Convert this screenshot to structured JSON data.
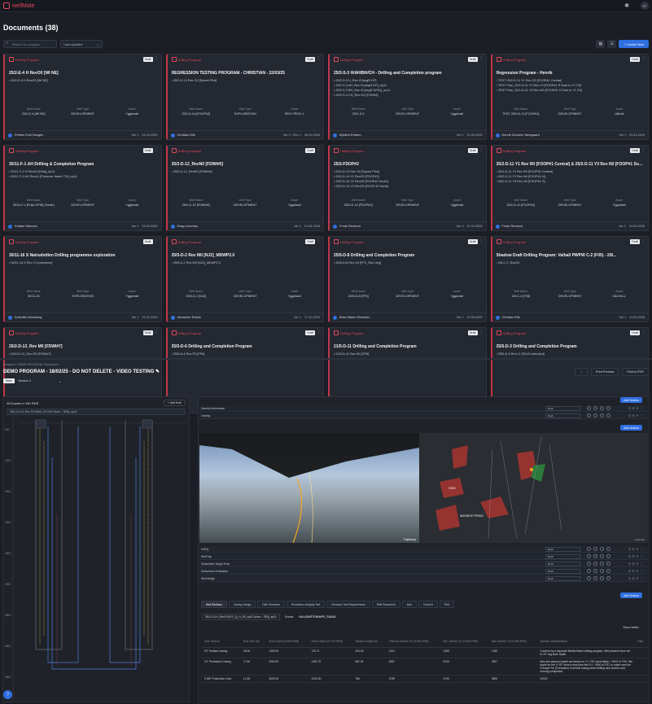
{
  "app": {
    "name": "wellMate",
    "user_initials": "RF"
  },
  "documents_title": "Documents (38)",
  "search": {
    "placeholder": "Search for program"
  },
  "sort": {
    "value": "Last updated"
  },
  "create_button": "+ Create New",
  "meta_labels": {
    "well": "Well Name",
    "type": "Well Type",
    "asset": "Asset"
  },
  "cards": [
    {
      "type": "Drilling Program",
      "badge": "Draft",
      "title": "25/2-E-4 H RevO0 [WI NE]",
      "items": [
        "25/2-E-4 H RevO0 [WI NE]"
      ],
      "well": "25/2-E-4 [WI NE]",
      "wtype": "DEVELOPMENT",
      "asset": "Yggdrasil",
      "user": "Preben Emil Haugen",
      "version": "Ver 1",
      "date": "01.04.2025"
    },
    {
      "type": "Drilling Program",
      "badge": "Draft",
      "title": "REGRESSION TESTING PROGRAM - CHRISTIAN - 22/03/25",
      "items": [
        "25/2-D-14 Rev G0 [Speed Pilot]"
      ],
      "well": "25/2-D-14 [FOOP#2]",
      "wtype": "EXPLORATION",
      "asset": "REG PROG 1",
      "user": "Christian Elle",
      "version": "Ver 3 - Rev 1",
      "date": "26.03.2025"
    },
    {
      "type": "Drilling Program",
      "badge": "Draft",
      "title": "25/2-S-3 H/AH/BH/CH - Drilling and Completion program",
      "items": [
        "25/2-S-3 H_Rev I0 [segR-DP]",
        "25/2-S-3 AH_Rev I0 [segR-DP]_ep11",
        "25/2-S-3 BH_Rev I0 [segR-DP#1]_ep11",
        "25/2-S-3 CH_Rev G0 [FOPAH]"
      ],
      "well": "25/2-S-3",
      "wtype": "DEVELOPMENT",
      "asset": "Yggdrasil",
      "user": "Øystein Eriksen",
      "version": "Ver 1",
      "date": "01.04.2025"
    },
    {
      "type": "Drilling Program",
      "badge": "Draft",
      "title": "Regression Program - Henrik",
      "items": [
        "TEST 25/2-D-11 Y1 Rev G0 [FOOP#1 Central]",
        "TEST Pian_25/2-D-11 Y2 Rev L0 [FOOP#1 R East to Y1 G0]",
        "TEST Pian_25/2-D-11 Y3 Rev M0 [FOOP#1 S East to Y1 G0]"
      ],
      "well": "TEST 25/2-D-11 [FOOP#1]",
      "wtype": "DEVELOPMENT",
      "asset": "Valhall",
      "user": "Henrik Schoeler Nøregaard",
      "version": "Ver 1",
      "date": "03.11.2024"
    },
    {
      "type": "Drilling Program",
      "badge": "Draft",
      "title": "30/11-F-1 AH Drilling & Completion Program",
      "items": [
        "30/11-F-1 H RevA0 [Fulla]_ep11",
        "30/11-F-1 AH RevA1 [Producer frame TDI]_ep11"
      ],
      "well": "30/11-F-1 [Fulla DPIS] (South)",
      "wtype": "DEVELOPMENT",
      "asset": "Yggdrasil",
      "user": "Kristian Wannes",
      "version": "Ver 1",
      "date": "03.03.2025"
    },
    {
      "type": "Drilling Program",
      "badge": "Draft",
      "title": "25/2-D-12_RevN0 [FDWI#5]",
      "items": [
        "25/2-D-12_RevN0 [FDWI#5]"
      ],
      "well": "25/2-D-12 [FDWI#5]",
      "wtype": "DEVELOPMENT",
      "asset": "Yggdrasil",
      "user": "Diego Acevedo",
      "version": "Ver 1",
      "date": "01.04.2025"
    },
    {
      "type": "Drilling Program",
      "badge": "Draft",
      "title": "25/2-FDOP#2",
      "items": [
        "25/2-D-14 Rev G0 [Speed Pilot]",
        "25/2-D-14 Y1 RevG0 [FDOP#2]",
        "25/2-D-14 Y2 RevG0 [FDOP#2 South]",
        "25/2-D-14 Y3 RevG0 [FDOP #2 North]"
      ],
      "well": "25/2-D-14 [FDOP#2]",
      "wtype": "DEVELOPMENT",
      "asset": "Yggdrasil",
      "user": "Frode Rivelund",
      "version": "Ver 3",
      "date": "01.04.2025"
    },
    {
      "type": "Drilling Program",
      "badge": "Draft",
      "title": "25/2-D-11 Y1 Rev R0 [FOOP#1 Central] & 25/2-D-11 Y3 Rev N0 [FOOP#1 South]",
      "items": [
        "25/2-D-11 Y1 Rev R0 [FOOP#1 Central]",
        "25/2-D-11 Y2 Rev N0 [FOOP#1 N]",
        "25/2-D-11 Y3 Rev N0 [FOOP#1 S]"
      ],
      "well": "25/2-D-11 [FOOP#1]",
      "wtype": "DEVELOPMENT",
      "asset": "Yggdrasil",
      "user": "Frode Rivelund",
      "version": "Ver 1",
      "date": "24.03.2025"
    },
    {
      "type": "Drilling Program",
      "badge": "Draft",
      "title": "30/11-16 S Natrudstilen Drilling programme exploration",
      "items": [
        "30/11-16 S Rev C1 [mainbore]"
      ],
      "well": "30/11-16",
      "wtype": "EXPLORATION",
      "asset": "Yggdrasil",
      "user": "Kristoffer Wansberg",
      "version": "Ver 1",
      "date": "07.01.2025"
    },
    {
      "type": "Drilling Program",
      "badge": "Draft",
      "title": "25/5-D-2 Rev M0 [NJ2]_MDWP2.0",
      "items": [
        "25/5-D-2 Rev M0 [NJ2]_MDWP2.0"
      ],
      "well": "25/5-D-2 [NJ2]",
      "wtype": "DEVELOPMENT",
      "asset": "Yggdrasil",
      "user": "Alexander Eriskis",
      "version": "Ver 1",
      "date": "17.10.2024"
    },
    {
      "type": "Drilling Program",
      "badge": "Draft",
      "title": "25/5-D-8 Drilling and Completion Program",
      "items": [
        "25/5-D-8 Rev U3 [FP4_Slot Ling]"
      ],
      "well": "25/5-D-8 [FP4]",
      "wtype": "DEVELOPMENT",
      "asset": "Yggdrasil",
      "user": "Brian Nilsen Sivertsen",
      "version": "Ver 1",
      "date": "22.08.2025"
    },
    {
      "type": "Drilling Program",
      "badge": "Draft",
      "title": "Shadow Draft Drilling Program: Valhall PWPW C-2 (F05) - 2/8...",
      "items": [
        "2/8-C-2_RevD3"
      ],
      "well": "2/8-C-2 [F05]",
      "wtype": "DEVELOPMENT",
      "asset": "VALHALL",
      "user": "Christian Elle",
      "version": "Ver 1",
      "date": "11.03.2025"
    },
    {
      "type": "Drilling Program",
      "badge": "Draft",
      "title": "25/2-D-13_Rev M0 [FDWI#7]",
      "items": [
        "25/2-D-13_Rev M0 [FDWI#7]"
      ],
      "well": "",
      "wtype": "",
      "asset": "",
      "user": "",
      "version": "",
      "date": ""
    },
    {
      "type": "Drilling Program",
      "badge": "Draft",
      "title": "25/5-D-6 Drilling and Completion Program",
      "items": [
        "25/5-D-6 Rev P0 [FP6]"
      ],
      "well": "",
      "wtype": "",
      "asset": "",
      "user": "",
      "version": "",
      "date": ""
    },
    {
      "type": "Drilling Program",
      "badge": "Draft",
      "title": "21/5-D-11 Drilling and Completion Program",
      "items": [
        "21/5-D-11 Rev M1 [FP5]"
      ],
      "well": "",
      "wtype": "",
      "asset": "",
      "user": "",
      "version": "",
      "date": ""
    },
    {
      "type": "Drilling Program",
      "badge": "Draft",
      "title": "25/5-D-3 Drilling and Completion Program",
      "items": [
        "25/5-D-3 Rev L1 [FNJ3 extended]"
      ],
      "well": "",
      "wtype": "",
      "asset": "",
      "user": "",
      "version": "",
      "date": ""
    }
  ],
  "demo": {
    "breadcrumb": "Programs / DEMO PROGRAM / Dashboard",
    "title": "DEMO PROGRAM - 18/02/25 - DO NOT DELETE - VIDEO TESTING",
    "print_preview": "Print Preview",
    "print_pdf": "Print to PDF",
    "main_chip": "Main",
    "version": "Version 2"
  },
  "left_panel": {
    "title": "All Depths in MD RKB",
    "add_btn": "+ Add Hole",
    "select": "25/2-S-4 H_Rev E0 [Well_8 H SD Victor - TBD]_ep11",
    "depths": [
      "500",
      "1000",
      "1500",
      "2000",
      "2500",
      "3000",
      "3500",
      "4000",
      "4500"
    ]
  },
  "right_panel": {
    "add_section": "Add Section",
    "rows_top": [
      "General Information",
      "Overlay"
    ],
    "rows_mid": [
      "HSEQ",
      "Well Dsp",
      "Subsurface Target Rock",
      "Subsurface Evaluation",
      "Well design"
    ],
    "draft": "Draft",
    "viz_label": "Trajectory",
    "map_labels": [
      "ODIN",
      "NORDEST FRIGG"
    ],
    "map_legend": "Heatmap"
  },
  "tabs": [
    "Well Sections",
    "Casing Design",
    "Risk Tolerance",
    "Production Integrity Test",
    "Pressure Test Requirements",
    "Well Placement",
    "Mud",
    "Cement",
    "P&A"
  ],
  "table": {
    "select": "25/2-S-4 H_Rev E0 [FG_Q_H_SD_ep11 Union - TBD]_ep11",
    "source_label": "Source:",
    "source_value": "HALLIBURTON/WIPE_RADIAL",
    "show_hidden": "Show Hidden",
    "headers": [
      "Hole Section",
      "Hole Size (in)",
      "Shoe Depth (m MD RKB)",
      "Shoe Depth (m TVD RKB)",
      "Section Length (m)",
      "Planned Section TD (m MD RKB)",
      "Min. Section TD (m MD RKB)",
      "Max Section TD (m MD RKB)",
      "Special Considerations",
      "Hide"
    ],
    "rows": [
      [
        "20\" Surface Casing",
        "26.00",
        "1300.00",
        "732.71",
        "204.00",
        "1321",
        "1305",
        "1330",
        "Covered by a separate Mobile Batch drilling program. Mini planned shoe set to 20\" csg shoe depth."
      ],
      [
        "14\" Production Casing",
        "17.50",
        "2000.00",
        "1187.70",
        "567.91",
        "2567",
        "2200",
        "2827",
        "Max and planned depth are based on 2 x TVD uncertainty + 2000 m TVD. Min depth for the 9 7/8\" shoe is less than the Fr1 ~3000 mTVD, to make sure the Grouper Fm (Formation) is behind casing when drilling next section and running completion."
      ],
      [
        "9 5/8\" Production Liner",
        "12.25",
        "3000.00",
        "2222.30",
        "784",
        "3789",
        "2750",
        "3800",
        "22022"
      ]
    ]
  }
}
